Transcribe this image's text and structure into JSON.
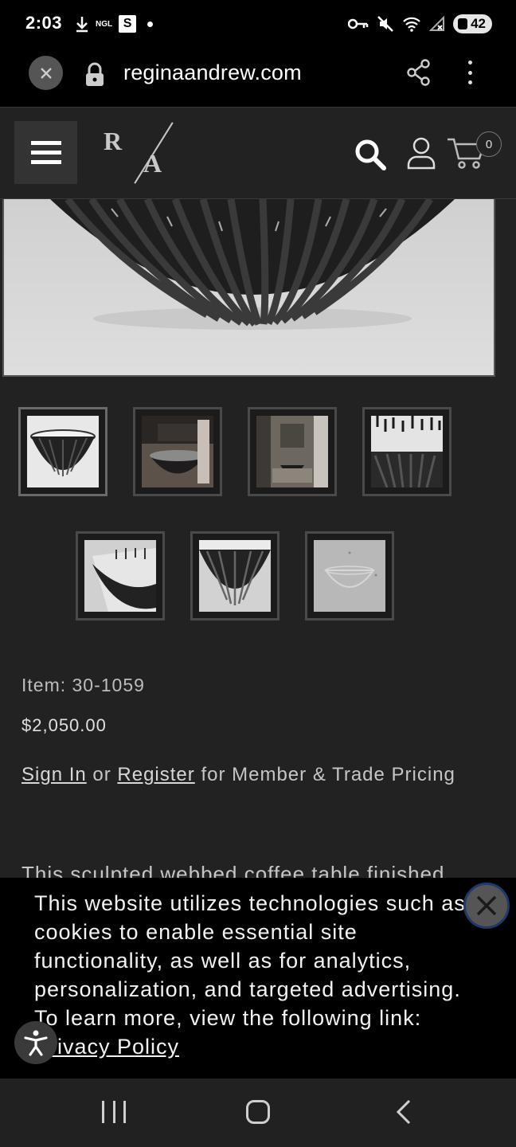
{
  "status_bar": {
    "time": "2:03",
    "carrier_tag": "NGL",
    "app_badge": "S",
    "battery": "42"
  },
  "browser": {
    "url": "reginaandrew.com"
  },
  "header": {
    "cart_count": "0",
    "logo_left": "R",
    "logo_right": "A"
  },
  "thumbnails": [
    {
      "name": "thumb-1"
    },
    {
      "name": "thumb-2"
    },
    {
      "name": "thumb-3"
    },
    {
      "name": "thumb-4"
    },
    {
      "name": "thumb-5"
    },
    {
      "name": "thumb-6"
    },
    {
      "name": "thumb-7"
    }
  ],
  "product": {
    "item_label": "Item: 30-1059",
    "price": "$2,050.00",
    "sign_in_link": "Sign In",
    "or_text": " or ",
    "register_link": "Register",
    "pricing_text": " for Member & Trade Pricing",
    "description_peek": "This sculpted webbed coffee table finished"
  },
  "cookie_banner": {
    "text": "This website utilizes technologies such as cookies to enable essential site functionality, as well as for analytics, personalization, and targeted advertising. To learn more, view the following link: ",
    "link": "Privacy Policy"
  }
}
